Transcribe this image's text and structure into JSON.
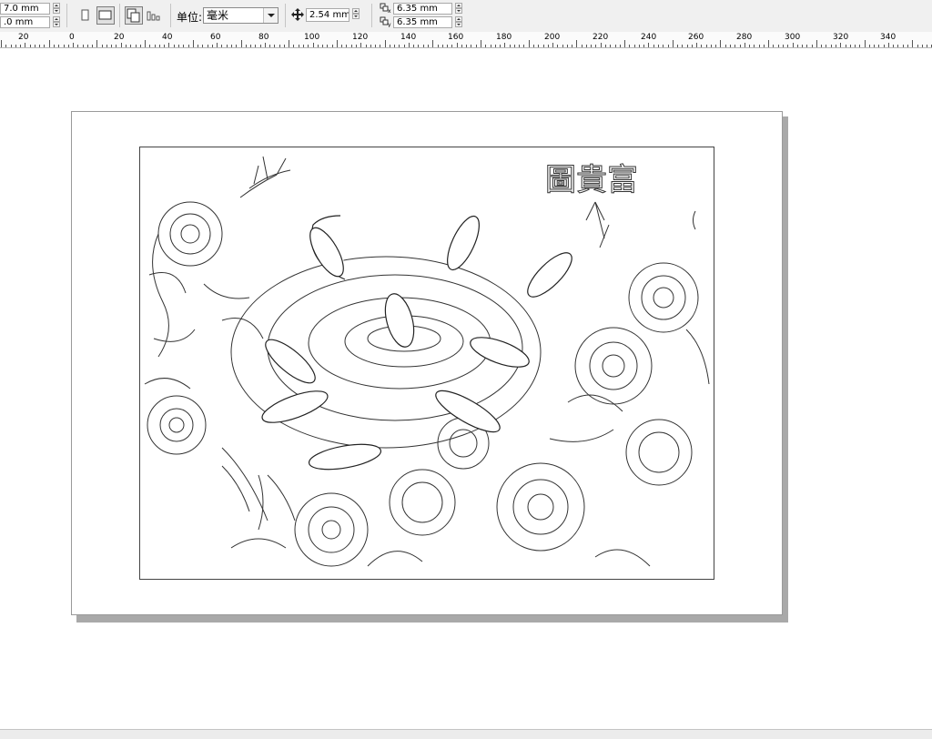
{
  "toolbar": {
    "pos_x": "7.0 mm",
    "pos_y": ".0 mm",
    "unit_label": "单位:",
    "unit_value": "毫米",
    "nudge_value": "2.54 mm",
    "dup_x": "6.35 mm",
    "dup_y": "6.35 mm"
  },
  "ruler": {
    "labels": [
      "20",
      "0",
      "20",
      "40",
      "60",
      "80",
      "100",
      "120",
      "140",
      "160",
      "180",
      "200",
      "220",
      "240",
      "260",
      "280",
      "300",
      "320",
      "340"
    ]
  },
  "artwork": {
    "title_chars": "圖貴富"
  },
  "icons": {
    "portrait": "portrait-page-icon",
    "landscape": "landscape-page-icon",
    "all_pages": "all-pages-icon",
    "current_page": "current-page-icon",
    "nudge": "nudge-icon",
    "duplicate_x": "duplicate-x-icon",
    "duplicate_y": "duplicate-y-icon"
  }
}
